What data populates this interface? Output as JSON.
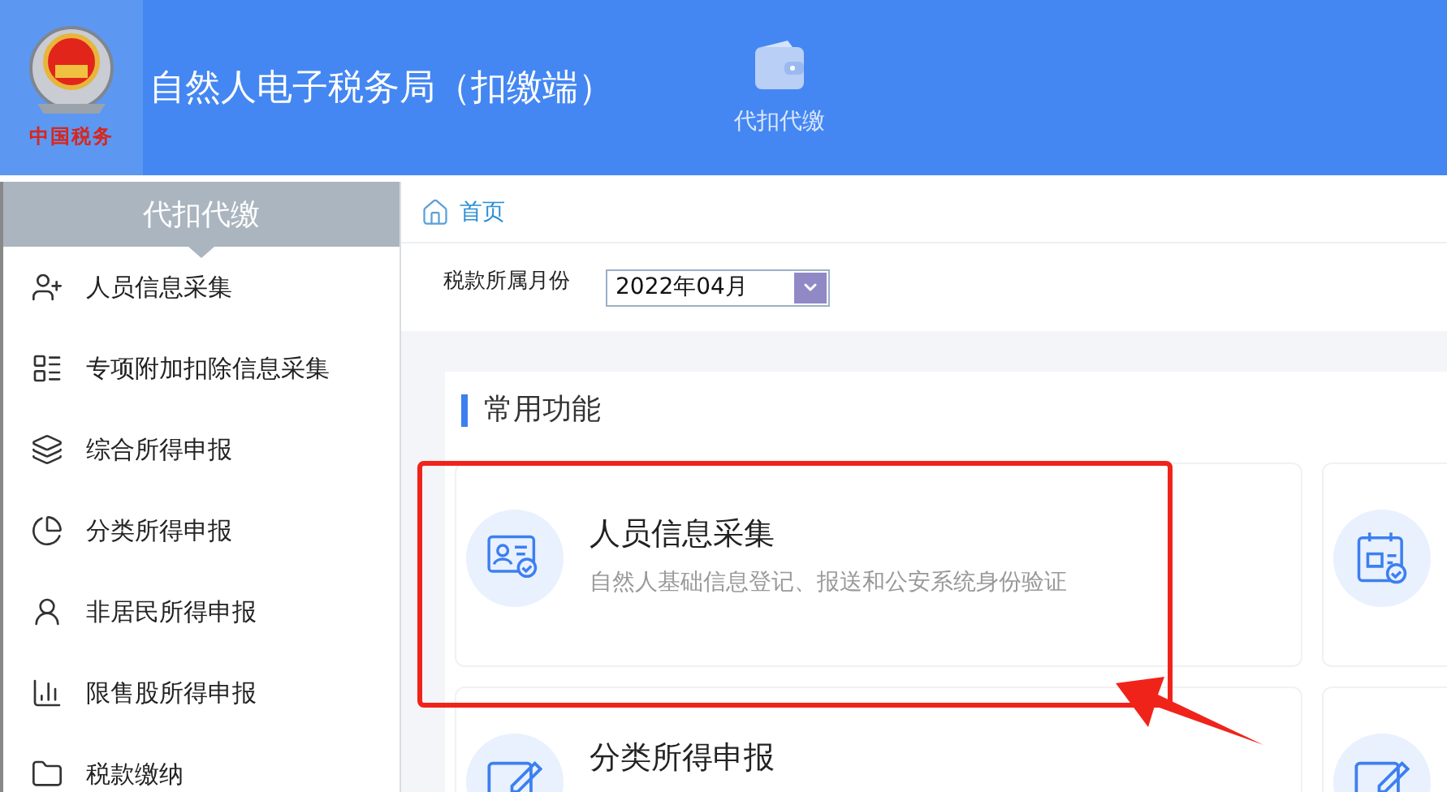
{
  "header": {
    "logo_text": "中国税务",
    "title": "自然人电子税务局（扣缴端）",
    "nav": [
      {
        "label": "代扣代缴",
        "kind": "wallet",
        "selected": true
      }
    ]
  },
  "sidebar": {
    "title": "代扣代缴",
    "items": [
      {
        "label": "人员信息采集",
        "kind": "user-plus"
      },
      {
        "label": "专项附加扣除信息采集",
        "kind": "list"
      },
      {
        "label": "综合所得申报",
        "kind": "layers"
      },
      {
        "label": "分类所得申报",
        "kind": "pie"
      },
      {
        "label": "非居民所得申报",
        "kind": "user-lines"
      },
      {
        "label": "限售股所得申报",
        "kind": "bars"
      },
      {
        "label": "税款缴纳",
        "kind": "folder"
      }
    ]
  },
  "breadcrumb": {
    "label": "首页"
  },
  "filter": {
    "label": "税款所属月份",
    "value": "2022年04月"
  },
  "section": {
    "title": "常用功能",
    "cards": [
      {
        "kind": "id-card",
        "title": "人员信息采集",
        "description": "自然人基础信息登记、报送和公安系统身份验证",
        "highlighted": true
      },
      {
        "kind": "tax-form",
        "highlighted": false
      },
      {
        "kind": "edit",
        "title": "分类所得申报",
        "highlighted": false
      },
      {
        "kind": "edit",
        "highlighted": false
      }
    ]
  }
}
